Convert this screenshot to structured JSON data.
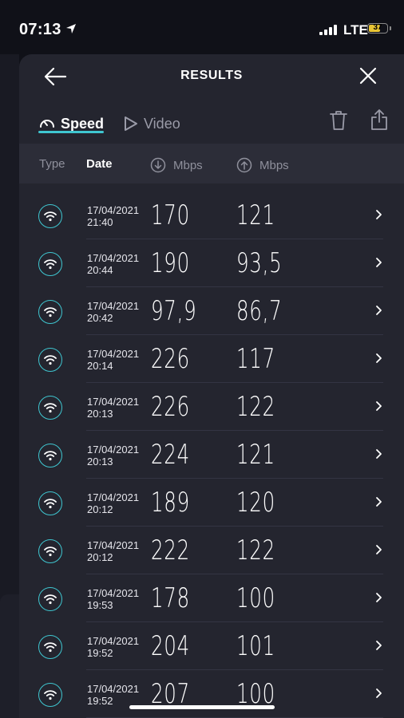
{
  "status_bar": {
    "time": "07:13",
    "network": "LTE",
    "battery": "37",
    "battery_color": "#e9c534"
  },
  "header": {
    "title": "RESULTS",
    "back_icon": "arrow-left-icon",
    "close_icon": "close-icon"
  },
  "tabs": [
    {
      "label": "Speed",
      "icon": "speedometer-icon",
      "active": true
    },
    {
      "label": "Video",
      "icon": "play-icon",
      "active": false
    }
  ],
  "actions": {
    "delete_icon": "trash-icon",
    "share_icon": "share-icon"
  },
  "columns": {
    "type": "Type",
    "date": "Date",
    "download": "Mbps",
    "upload": "Mbps"
  },
  "accent_color": "#3fc6d0",
  "results": [
    {
      "date": "17/04/2021",
      "time": "21:40",
      "down": "170",
      "up": "121"
    },
    {
      "date": "17/04/2021",
      "time": "20:44",
      "down": "190",
      "up": "93,5"
    },
    {
      "date": "17/04/2021",
      "time": "20:42",
      "down": "97,9",
      "up": "86,7"
    },
    {
      "date": "17/04/2021",
      "time": "20:14",
      "down": "226",
      "up": "117"
    },
    {
      "date": "17/04/2021",
      "time": "20:13",
      "down": "226",
      "up": "122"
    },
    {
      "date": "17/04/2021",
      "time": "20:13",
      "down": "224",
      "up": "121"
    },
    {
      "date": "17/04/2021",
      "time": "20:12",
      "down": "189",
      "up": "120"
    },
    {
      "date": "17/04/2021",
      "time": "20:12",
      "down": "222",
      "up": "122"
    },
    {
      "date": "17/04/2021",
      "time": "19:53",
      "down": "178",
      "up": "100"
    },
    {
      "date": "17/04/2021",
      "time": "19:52",
      "down": "204",
      "up": "101"
    },
    {
      "date": "17/04/2021",
      "time": "19:52",
      "down": "207",
      "up": "100"
    }
  ]
}
